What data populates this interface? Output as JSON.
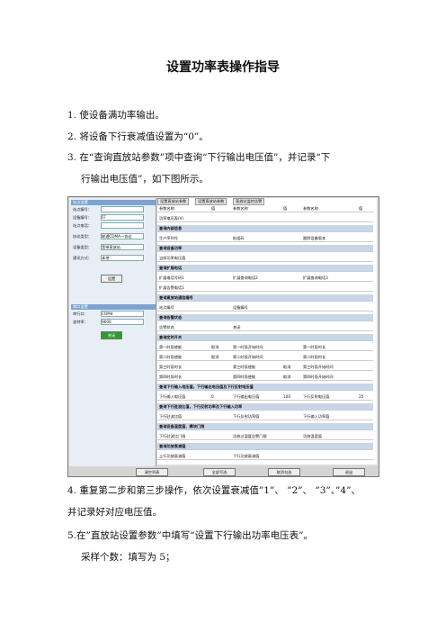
{
  "title": "设置功率表操作指导",
  "steps": [
    "1. 使设备满功率输出。",
    "2. 将设备下行衰减值设置为“0”。",
    "3. 在“查询直放站参数”项中查询“下行输出电压值”，并记录“下",
    "行输出电压值”，如下图所示。",
    "4. 重复第二步和第三步操作，依次设置衰减值”1”、 ”2”、 ”3”、”4”、",
    "并记录好对应电压值。",
    "5.在”直放站设置参数”中填写“设置下行输出功率电压表”。",
    "采样个数：填写为 5；"
  ],
  "screenshot": {
    "left_sections": [
      "站点设置",
      "串口设置"
    ],
    "left_labels": [
      "站点编号：",
      "设备编号：",
      "站点电话：",
      "协议类型：",
      "设备类型：",
      "通讯方式：",
      "串行口：",
      "波特率："
    ],
    "left_values": [
      "",
      "FF",
      "",
      "联通CDMA一协议",
      "宽带直放站",
      "本地",
      "COM4",
      "9600"
    ],
    "left_buttons": [
      "设置",
      "关闭"
    ],
    "tabs": [
      "设置直放站参数",
      "设置直放站参数",
      "直放站监控告警"
    ],
    "rows": [
      {
        "h": false,
        "c": [
          "参数名称",
          "值",
          "参数名称",
          "值",
          "参数名称",
          "值"
        ]
      },
      {
        "h": false,
        "c": [
          "功率电压表(V)",
          "",
          "",
          "",
          "",
          ""
        ]
      },
      {
        "h": true,
        "c": [
          "查询内部信息",
          "",
          "",
          "",
          "",
          ""
        ]
      },
      {
        "h": false,
        "c": [
          "生产序列号",
          "",
          "批组码",
          "",
          "跟踪设备版本",
          ""
        ]
      },
      {
        "h": true,
        "c": [
          "查询设备功率",
          "",
          "",
          "",
          "",
          ""
        ]
      },
      {
        "h": false,
        "c": [
          "当前功率电压值",
          "",
          "",
          "",
          "",
          ""
        ]
      },
      {
        "h": true,
        "c": [
          "查询扩展电话",
          "",
          "",
          "",
          "",
          ""
        ]
      },
      {
        "h": false,
        "c": [
          "扩展电话号码1",
          "",
          "扩展查询电话2",
          "",
          "扩展查询电话3",
          ""
        ]
      },
      {
        "h": false,
        "c": [
          "扩展告警电话1",
          "",
          "",
          "",
          "",
          ""
        ]
      },
      {
        "h": true,
        "c": [
          "查询直放站通信编号",
          "",
          "",
          "",
          "",
          ""
        ]
      },
      {
        "h": false,
        "c": [
          "站点编号",
          "",
          "设备编号",
          "",
          "",
          ""
        ]
      },
      {
        "h": true,
        "c": [
          "查询告警状态",
          "",
          "",
          "",
          "",
          ""
        ]
      },
      {
        "h": false,
        "c": [
          "告警状态",
          "",
          "关闭",
          "",
          "",
          ""
        ]
      },
      {
        "h": true,
        "c": [
          "查询定时开关",
          "",
          "",
          "",
          "",
          ""
        ]
      },
      {
        "h": false,
        "c": [
          "第一时段使能",
          "取消",
          "第一时段开始时间",
          "",
          "第一时段时长",
          ""
        ]
      },
      {
        "h": false,
        "c": [
          "第二时段使能",
          "取消",
          "第二时段开始时间",
          "",
          "第二时段时长",
          ""
        ]
      },
      {
        "h": false,
        "c": [
          "第三时段时长",
          "",
          "第三时段使能",
          "取消",
          "第三时段开始时间",
          ""
        ]
      },
      {
        "h": false,
        "c": [
          "第四时段时长",
          "",
          "第四时段使能",
          "取消",
          "第四时段开始时间",
          ""
        ]
      },
      {
        "h": true,
        "c": [
          "查询下行输入电压值，下行输出电压值及下行反射电压值",
          "",
          "",
          "",
          "",
          ""
        ]
      },
      {
        "h": false,
        "c": [
          "下行输入电压值",
          "0",
          "下行输出电压值",
          "100",
          "下行反射电压值",
          "25"
        ]
      },
      {
        "h": true,
        "c": [
          "查询下行驻波比值，下行反射功率及下行输入功率",
          "",
          "",
          "",
          "",
          ""
        ]
      },
      {
        "h": false,
        "c": [
          "下行驻波比值",
          "",
          "下行反射功率值",
          "",
          "下行输入功率值",
          ""
        ]
      },
      {
        "h": true,
        "c": [
          "查询设备温度值、模块门限",
          "",
          "",
          "",
          "",
          ""
        ]
      },
      {
        "h": false,
        "c": [
          "下行驻波比门限",
          "",
          "功放过温度告警门限",
          "",
          "功放温度值",
          ""
        ]
      },
      {
        "h": true,
        "c": [
          "查询功放衰减值",
          "",
          "",
          "",
          "",
          ""
        ]
      },
      {
        "h": false,
        "c": [
          "上行功放衰减值",
          "",
          "下行功放衰减值",
          "",
          "",
          ""
        ]
      }
    ],
    "bottom_buttons": [
      "清空列表",
      "全部写选",
      "取消勾选",
      "退出"
    ]
  }
}
